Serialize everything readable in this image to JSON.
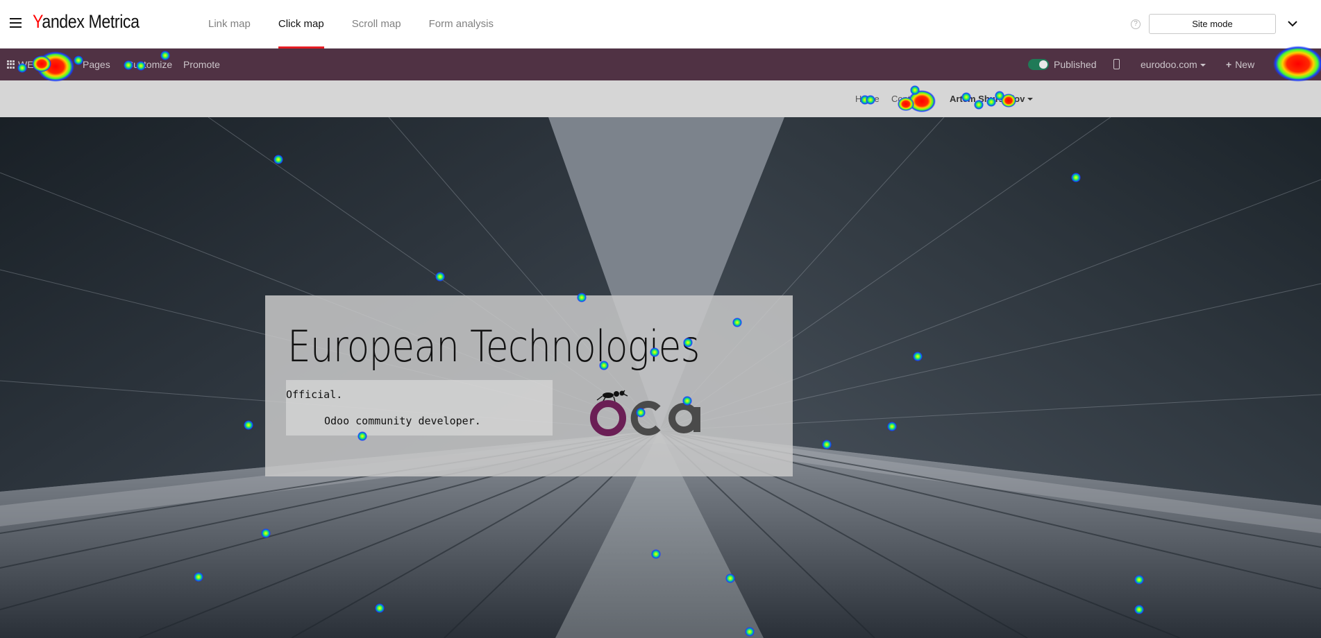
{
  "metrica": {
    "logo_y": "Y",
    "logo_rest": "andex Metrica",
    "tabs": [
      "Link map",
      "Click map",
      "Scroll map",
      "Form analysis"
    ],
    "active_tab": "Click map",
    "site_mode_label": "Site mode",
    "help_glyph": "?"
  },
  "editor_bar": {
    "website_label": "WEBSITE",
    "pages_label": "Pages",
    "customize_label": "Customize",
    "promote_label": "Promote",
    "published_label": "Published",
    "domain_label": "eurodoo.com",
    "new_label": "New",
    "new_glyph": "+",
    "bar_color": "#503244"
  },
  "site_nav": {
    "home_label": "Home",
    "contact_label": "Contact us",
    "user_label": "Artem Shurshilov"
  },
  "hero": {
    "title": "European Technologies",
    "code_line1": "Official.",
    "code_line2": "Odoo community developer."
  },
  "icons": {
    "menu": "hamburger-icon",
    "help": "question-circle-icon",
    "collapse": "chevron-down-icon",
    "apps": "grid-icon",
    "mobile": "mobile-icon",
    "new": "plus-icon"
  },
  "colors": {
    "active_tab_underline": "#e51c23",
    "logo_accent": "#ff0000",
    "toggle_on": "#1f7a57",
    "oca_purple": "#6b1e55",
    "oca_grey": "#4a4a4a"
  }
}
